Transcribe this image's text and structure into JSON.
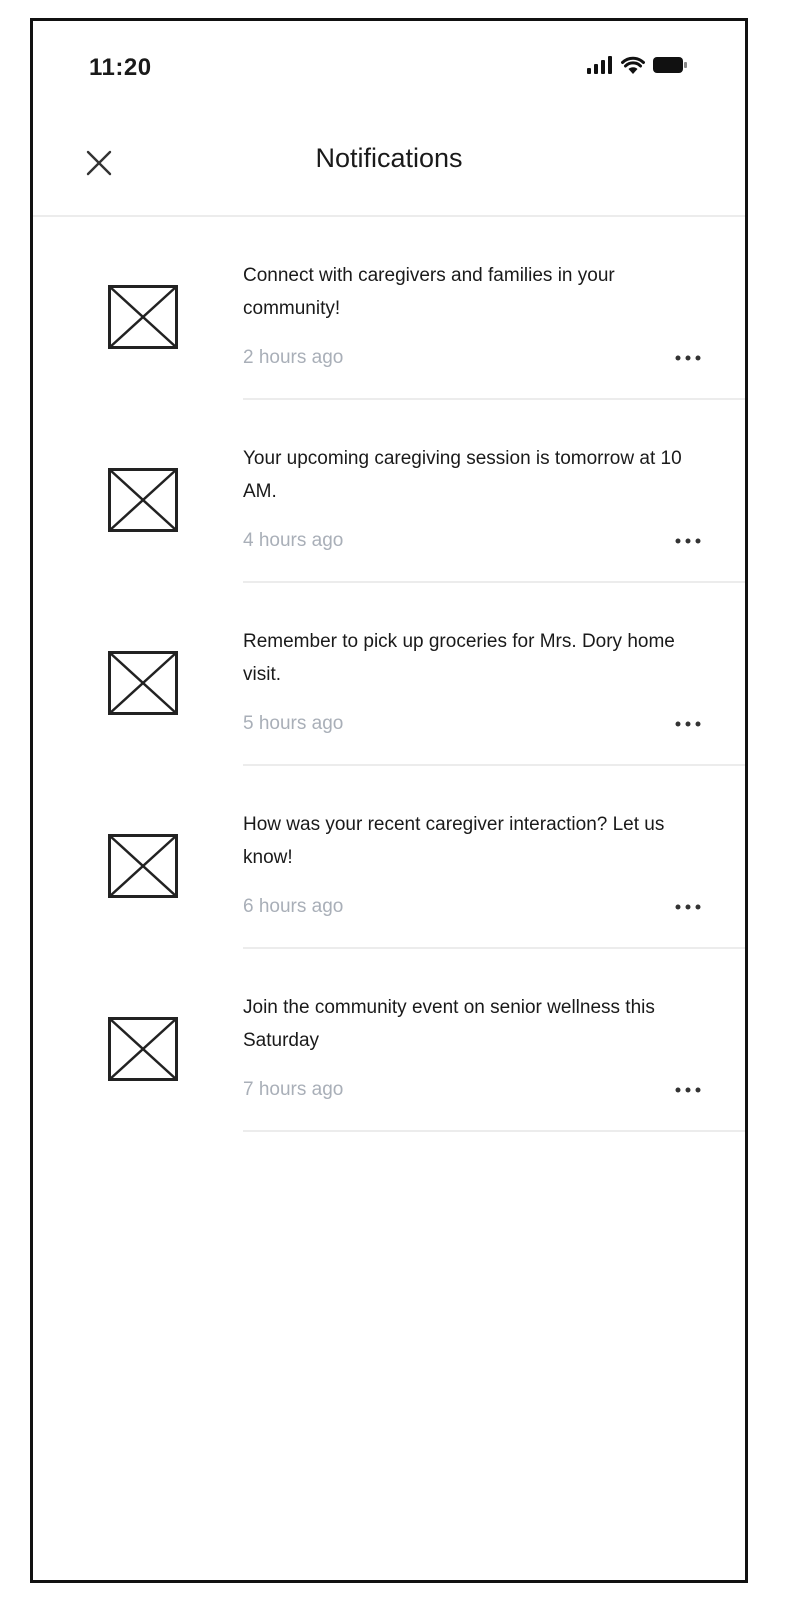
{
  "status_bar": {
    "time": "11:20",
    "icons": [
      "signal-icon",
      "wifi-icon",
      "battery-icon"
    ]
  },
  "header": {
    "title": "Notifications",
    "close_icon": "close-icon"
  },
  "notifications": [
    {
      "text": "Connect with caregivers and families in your community!",
      "time": "2 hours ago"
    },
    {
      "text": "Your upcoming caregiving session is tomorrow at 10 AM.",
      "time": "4 hours ago"
    },
    {
      "text": "Remember to pick up groceries for Mrs. Dory home visit.",
      "time": "5 hours ago"
    },
    {
      "text": "How was your recent caregiver interaction? Let us know!",
      "time": "6 hours ago"
    },
    {
      "text": "Join the community event on senior wellness this Saturday",
      "time": "7 hours ago"
    }
  ],
  "colors": {
    "text": "#1a1a1a",
    "timestamp": "#a9afb8",
    "divider": "#ececec",
    "frame": "#111111"
  }
}
